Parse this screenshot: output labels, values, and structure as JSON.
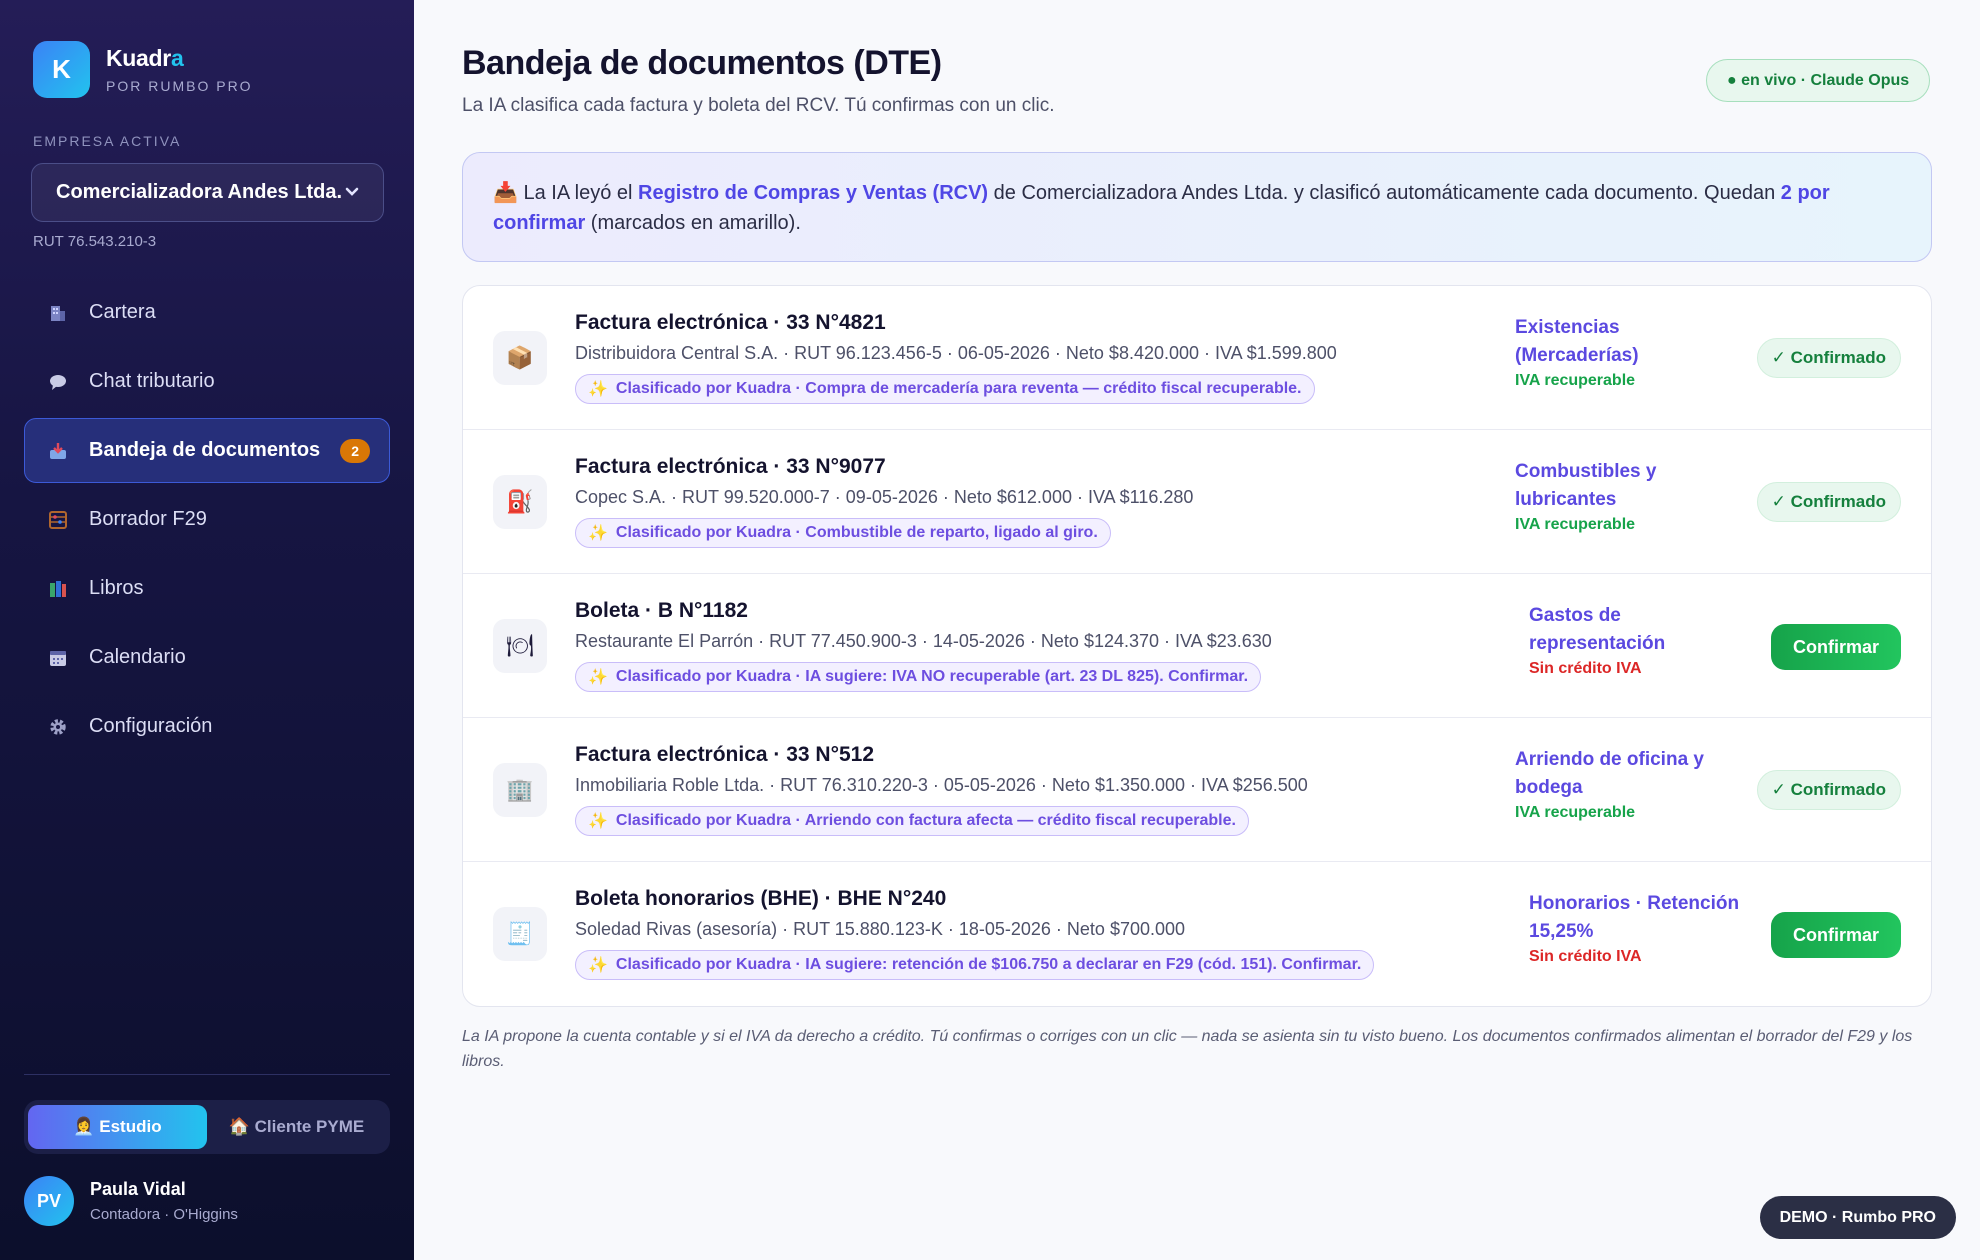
{
  "brand": {
    "name_main": "Kuadr",
    "name_accent": "a",
    "sub": "POR RUMBO PRO",
    "logo_letter": "K"
  },
  "company": {
    "label": "EMPRESA ACTIVA",
    "selected": "Comercializadora Andes Ltda.",
    "rut": "RUT 76.543.210-3"
  },
  "nav": [
    {
      "label": "Cartera",
      "icon": "building-icon"
    },
    {
      "label": "Chat tributario",
      "icon": "chat-icon"
    },
    {
      "label": "Bandeja de documentos",
      "icon": "inbox-icon",
      "badge": "2",
      "active": true
    },
    {
      "label": "Borrador F29",
      "icon": "abacus-icon"
    },
    {
      "label": "Libros",
      "icon": "books-icon"
    },
    {
      "label": "Calendario",
      "icon": "calendar-icon"
    },
    {
      "label": "Configuración",
      "icon": "gear-icon"
    }
  ],
  "mode_toggle": {
    "studio": "👩‍💼 Estudio",
    "client": "🏠 Cliente PYME",
    "active": "studio"
  },
  "user": {
    "initials": "PV",
    "name": "Paula Vidal",
    "role": "Contadora · O'Higgins"
  },
  "header": {
    "title": "Bandeja de documentos (DTE)",
    "subtitle": "La IA clasifica cada factura y boleta del RCV. Tú confirmas con un clic.",
    "live": "● en vivo · Claude Opus"
  },
  "info": {
    "t1": "La IA leyó el ",
    "link": "Registro de Compras y Ventas (RCV)",
    "t2": " de Comercializadora Andes Ltda. y clasificó automáticamente cada documento. Quedan ",
    "count": "2 por confirmar",
    "t3": " (marcados en amarillo)."
  },
  "documents": [
    {
      "icon": "📦",
      "icon_name": "package-icon",
      "title": "Factura electrónica · 33 N°4821",
      "meta": "Distribuidora Central S.A. · RUT 96.123.456-5 · 06-05-2026 · Neto $8.420.000 · IVA $1.599.800",
      "ai": "Clasificado por Kuadra · Compra de mercadería para reventa — crédito fiscal recuperable.",
      "category": "Existencias (Mercaderías)",
      "iva": "IVA recuperable",
      "iva_ok": true,
      "status": "✓ Confirmado",
      "confirmed": true
    },
    {
      "icon": "⛽",
      "icon_name": "fuel-pump-icon",
      "title": "Factura electrónica · 33 N°9077",
      "meta": "Copec S.A. · RUT 99.520.000-7 · 09-05-2026 · Neto $612.000 · IVA $116.280",
      "ai": "Clasificado por Kuadra · Combustible de reparto, ligado al giro.",
      "category": "Combustibles y lubricantes",
      "iva": "IVA recuperable",
      "iva_ok": true,
      "status": "✓ Confirmado",
      "confirmed": true
    },
    {
      "icon": "🍽",
      "icon_name": "dining-icon",
      "title": "Boleta · B N°1182",
      "meta": "Restaurante El Parrón · RUT 77.450.900-3 · 14-05-2026 · Neto $124.370 · IVA $23.630",
      "ai": "Clasificado por Kuadra · IA sugiere: IVA NO recuperable (art. 23 DL 825). Confirmar.",
      "category": "Gastos de representación",
      "iva": "Sin crédito IVA",
      "iva_ok": false,
      "status": "Confirmar",
      "confirmed": false
    },
    {
      "icon": "🏢",
      "icon_name": "office-building-icon",
      "title": "Factura electrónica · 33 N°512",
      "meta": "Inmobiliaria Roble Ltda. · RUT 76.310.220-3 · 05-05-2026 · Neto $1.350.000 · IVA $256.500",
      "ai": "Clasificado por Kuadra · Arriendo con factura afecta — crédito fiscal recuperable.",
      "category": "Arriendo de oficina y bodega",
      "iva": "IVA recuperable",
      "iva_ok": true,
      "status": "✓ Confirmado",
      "confirmed": true
    },
    {
      "icon": "🧾",
      "icon_name": "receipt-icon",
      "title": "Boleta honorarios (BHE) · BHE N°240",
      "meta": "Soledad Rivas (asesoría) · RUT 15.880.123-K · 18-05-2026 · Neto $700.000",
      "ai": "Clasificado por Kuadra · IA sugiere: retención de $106.750 a declarar en F29 (cód. 151). Confirmar.",
      "category": "Honorarios · Retención 15,25%",
      "iva": "Sin crédito IVA",
      "iva_ok": false,
      "status": "Confirmar",
      "confirmed": false
    }
  ],
  "footnote": "La IA propone la cuenta contable y si el IVA da derecho a crédito. Tú confirmas o corriges con un clic — nada se asienta sin tu visto bueno. Los documentos confirmados alimentan el borrador del F29 y los libros.",
  "demo": "DEMO · Rumbo PRO"
}
